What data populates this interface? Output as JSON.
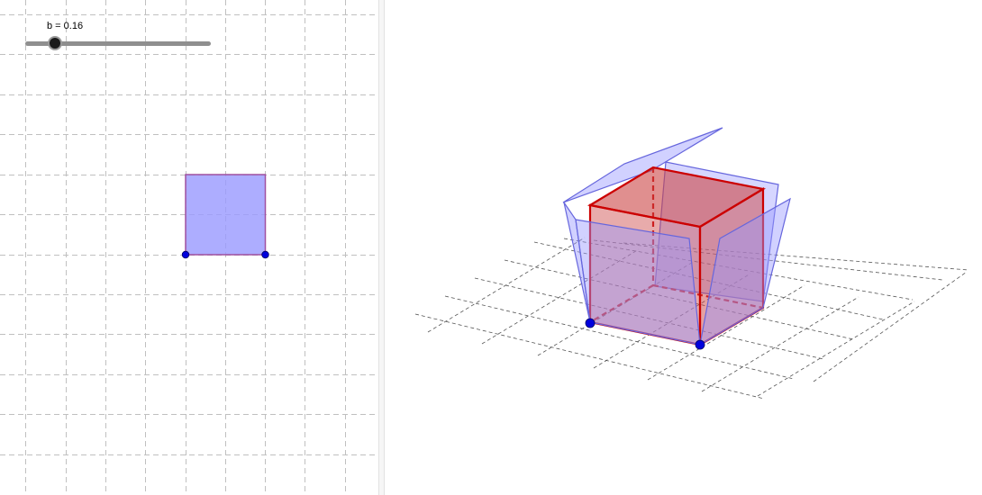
{
  "slider": {
    "name": "b",
    "value": 0.16,
    "min": 0,
    "max": 1,
    "caption": "b = 0.16"
  },
  "colors": {
    "grid": "#c0c0c0",
    "square_fill": "#9999ff",
    "square_stroke": "#a050a0",
    "point": "#0000dd",
    "cube_fill": "#cc4444",
    "cube_edge": "#cc0000",
    "flap_fill": "#9999ff",
    "flap_stroke": "#6666dd"
  },
  "icons": {
    "point": "blue-point-icon",
    "slider_knob": "slider-knob-icon"
  }
}
